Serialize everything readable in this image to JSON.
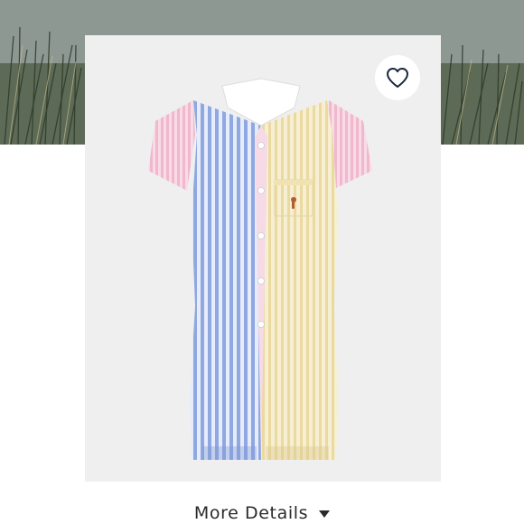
{
  "product": {
    "image_name": "striped-fun-shirt-shortall",
    "colors": {
      "blue_stripe": "#8fa8e0",
      "yellow_stripe": "#efe0b0",
      "pink_sleeve": "#f3c6d8",
      "green_collar_stripe": "#9fd0b0",
      "background": "#efefef"
    }
  },
  "actions": {
    "favorite_icon": "heart-outline-icon",
    "more_details_label": "More Details",
    "more_details_icon": "caret-down-icon"
  }
}
